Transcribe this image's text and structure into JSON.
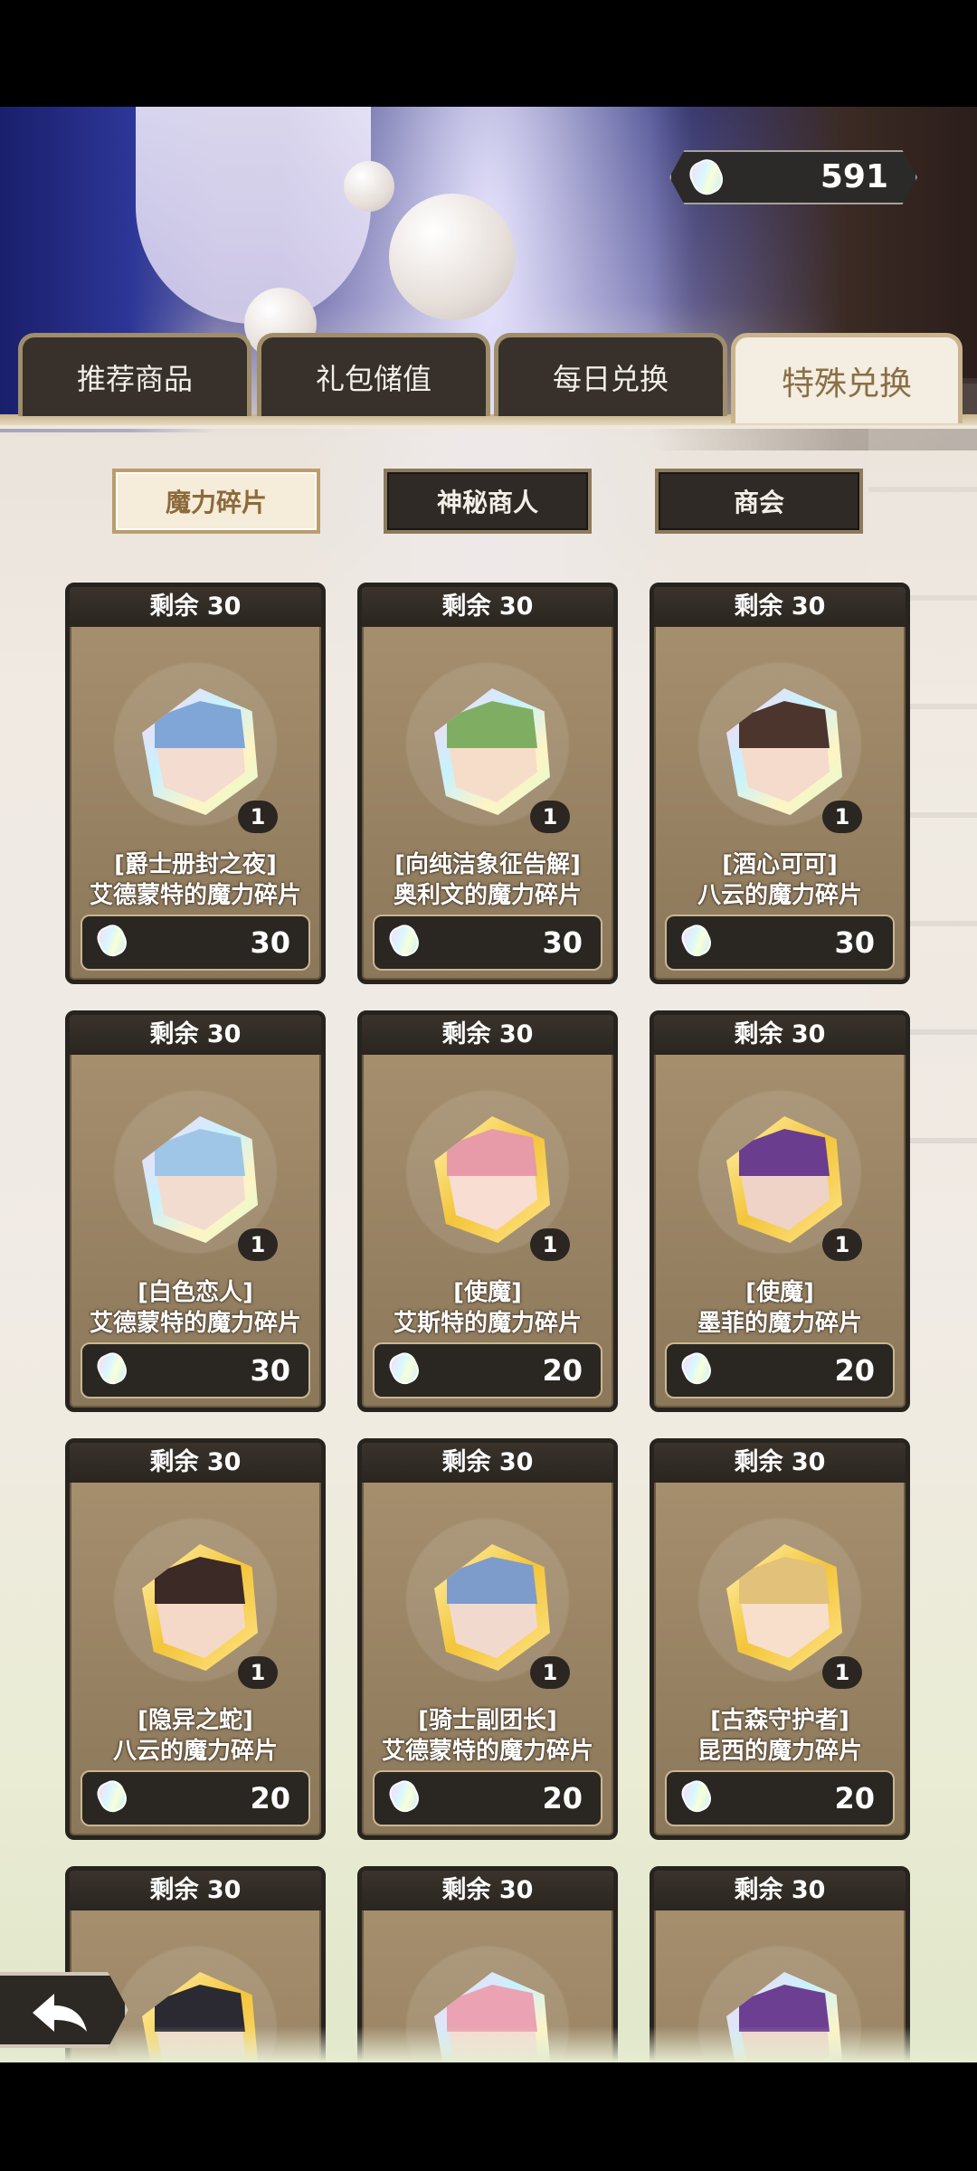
{
  "currency": {
    "amount": "591",
    "icon": "crystal-gem-icon"
  },
  "tabs": [
    {
      "label": "推荐商品",
      "active": false
    },
    {
      "label": "礼包储值",
      "active": false
    },
    {
      "label": "每日兑换",
      "active": false
    },
    {
      "label": "特殊兑换",
      "active": true
    }
  ],
  "subtabs": [
    {
      "label": "魔力碎片",
      "active": true
    },
    {
      "label": "神秘商人",
      "active": false
    },
    {
      "label": "商会",
      "active": false
    }
  ],
  "items": [
    {
      "remain": "剩余 30",
      "title": "[爵士册封之夜]",
      "name": "艾德蒙特的魔力碎片",
      "qty": "1",
      "price": "30"
    },
    {
      "remain": "剩余 30",
      "title": "[向纯洁象征告解]",
      "name": "奥利文的魔力碎片",
      "qty": "1",
      "price": "30"
    },
    {
      "remain": "剩余 30",
      "title": "[酒心可可]",
      "name": "八云的魔力碎片",
      "qty": "1",
      "price": "30"
    },
    {
      "remain": "剩余 30",
      "title": "[白色恋人]",
      "name": "艾德蒙特的魔力碎片",
      "qty": "1",
      "price": "30"
    },
    {
      "remain": "剩余 30",
      "title": "[使魔]",
      "name": "艾斯特的魔力碎片",
      "qty": "1",
      "price": "20"
    },
    {
      "remain": "剩余 30",
      "title": "[使魔]",
      "name": "墨菲的魔力碎片",
      "qty": "1",
      "price": "20"
    },
    {
      "remain": "剩余 30",
      "title": "[隐异之蛇]",
      "name": "八云的魔力碎片",
      "qty": "1",
      "price": "20"
    },
    {
      "remain": "剩余 30",
      "title": "[骑士副团长]",
      "name": "艾德蒙特的魔力碎片",
      "qty": "1",
      "price": "20"
    },
    {
      "remain": "剩余 30",
      "title": "[古森守护者]",
      "name": "昆西的魔力碎片",
      "qty": "1",
      "price": "20"
    },
    {
      "remain": "剩余 30"
    },
    {
      "remain": "剩余 30"
    },
    {
      "remain": "剩余 30"
    }
  ],
  "back_icon": "back-arrow-icon"
}
